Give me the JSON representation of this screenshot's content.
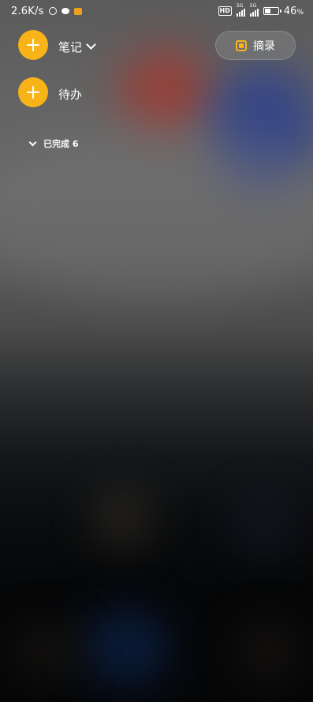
{
  "status_bar": {
    "network_speed": "2.6K/s",
    "icons": [
      "alarm-icon",
      "chat-icon",
      "app-notification-icon"
    ],
    "hd_badge": "HD",
    "signal_1": "5G",
    "signal_2": "5G",
    "battery_percent": "46",
    "battery_unit": "%",
    "battery_level": 0.46
  },
  "header": {
    "notes_label": "笔记",
    "excerpt_label": "摘录"
  },
  "todo": {
    "label": "待办",
    "completed_label": "已完成 6"
  },
  "colors": {
    "accent": "#f7b317"
  }
}
